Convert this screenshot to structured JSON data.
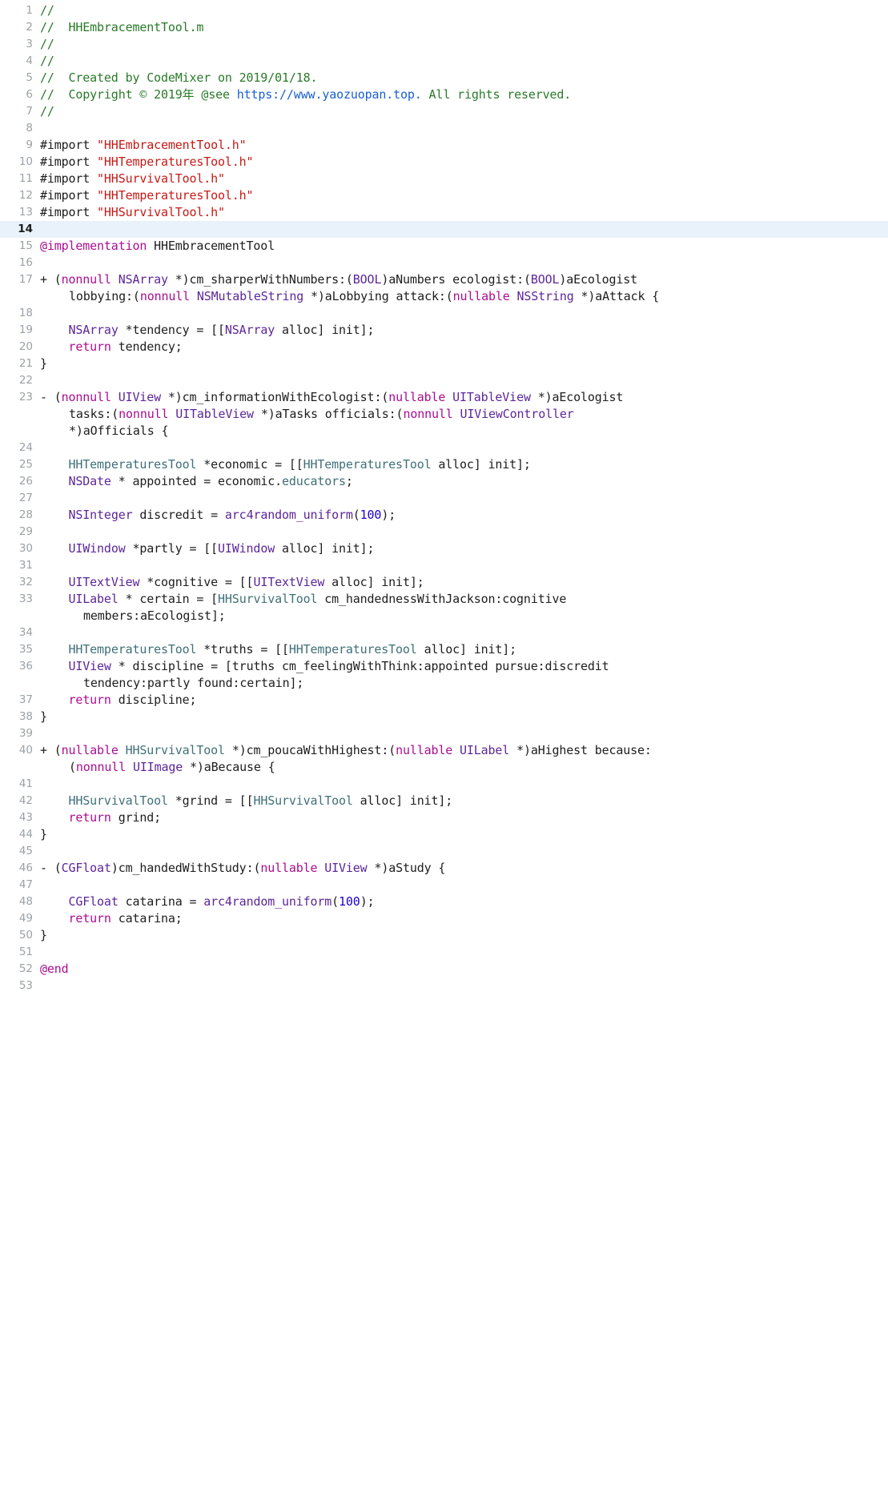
{
  "editor": {
    "language": "objective-c",
    "file_name": "HHEmbracementTool.m",
    "active_line": 14,
    "total_lines": 53,
    "colors": {
      "background": "#ffffff",
      "active_line": "#e9f1fb",
      "gutter_text": "#9ba1a6",
      "comment": "#297a29",
      "link": "#1a5fd0",
      "string": "#c41a16",
      "keyword": "#aa0d91",
      "type": "#5c2699",
      "user_class": "#3f7078",
      "number": "#1c00cf",
      "default_text": "#1d1d1f"
    }
  },
  "lines": [
    {
      "n": "1",
      "text": "//"
    },
    {
      "n": "2",
      "text": "//  HHEmbracementTool.m"
    },
    {
      "n": "3",
      "text": "//"
    },
    {
      "n": "4",
      "text": "//"
    },
    {
      "n": "5",
      "text": "//  Created by CodeMixer on 2019/01/18."
    },
    {
      "n": "6",
      "text": "//  Copyright © 2019年 @see https://www.yaozuopan.top. All rights reserved."
    },
    {
      "n": "7",
      "text": "//"
    },
    {
      "n": "8",
      "text": ""
    },
    {
      "n": "9",
      "text": "#import \"HHEmbracementTool.h\""
    },
    {
      "n": "10",
      "text": "#import \"HHTemperaturesTool.h\""
    },
    {
      "n": "11",
      "text": "#import \"HHSurvivalTool.h\""
    },
    {
      "n": "12",
      "text": "#import \"HHTemperaturesTool.h\""
    },
    {
      "n": "13",
      "text": "#import \"HHSurvivalTool.h\""
    },
    {
      "n": "14",
      "text": ""
    },
    {
      "n": "15",
      "text": "@implementation HHEmbracementTool"
    },
    {
      "n": "16",
      "text": ""
    },
    {
      "n": "17",
      "text": "+ (nonnull NSArray *)cm_sharperWithNumbers:(BOOL)aNumbers ecologist:(BOOL)aEcologist lobbying:(nonnull NSMutableString *)aLobbying attack:(nullable NSString *)aAttack {"
    },
    {
      "n": "18",
      "text": ""
    },
    {
      "n": "19",
      "text": "    NSArray *tendency = [[NSArray alloc] init];"
    },
    {
      "n": "20",
      "text": "    return tendency;"
    },
    {
      "n": "21",
      "text": "}"
    },
    {
      "n": "22",
      "text": ""
    },
    {
      "n": "23",
      "text": "- (nonnull UIView *)cm_informationWithEcologist:(nullable UITableView *)aEcologist tasks:(nonnull UITableView *)aTasks officials:(nonnull UIViewController *)aOfficials {"
    },
    {
      "n": "24",
      "text": ""
    },
    {
      "n": "25",
      "text": "    HHTemperaturesTool *economic = [[HHTemperaturesTool alloc] init];"
    },
    {
      "n": "26",
      "text": "    NSDate * appointed = economic.educators;"
    },
    {
      "n": "27",
      "text": ""
    },
    {
      "n": "28",
      "text": "    NSInteger discredit = arc4random_uniform(100);"
    },
    {
      "n": "29",
      "text": ""
    },
    {
      "n": "30",
      "text": "    UIWindow *partly = [[UIWindow alloc] init];"
    },
    {
      "n": "31",
      "text": ""
    },
    {
      "n": "32",
      "text": "    UITextView *cognitive = [[UITextView alloc] init];"
    },
    {
      "n": "33",
      "text": "    UILabel * certain = [HHSurvivalTool cm_handednessWithJackson:cognitive members:aEcologist];"
    },
    {
      "n": "34",
      "text": ""
    },
    {
      "n": "35",
      "text": "    HHTemperaturesTool *truths = [[HHTemperaturesTool alloc] init];"
    },
    {
      "n": "36",
      "text": "    UIView * discipline = [truths cm_feelingWithThink:appointed pursue:discredit tendency:partly found:certain];"
    },
    {
      "n": "37",
      "text": "    return discipline;"
    },
    {
      "n": "38",
      "text": "}"
    },
    {
      "n": "39",
      "text": ""
    },
    {
      "n": "40",
      "text": "+ (nullable HHSurvivalTool *)cm_poucaWithHighest:(nullable UILabel *)aHighest because:(nonnull UIImage *)aBecause {"
    },
    {
      "n": "41",
      "text": ""
    },
    {
      "n": "42",
      "text": "    HHSurvivalTool *grind = [[HHSurvivalTool alloc] init];"
    },
    {
      "n": "43",
      "text": "    return grind;"
    },
    {
      "n": "44",
      "text": "}"
    },
    {
      "n": "45",
      "text": ""
    },
    {
      "n": "46",
      "text": "- (CGFloat)cm_handedWithStudy:(nullable UIView *)aStudy {"
    },
    {
      "n": "47",
      "text": ""
    },
    {
      "n": "48",
      "text": "    CGFloat catarina = arc4random_uniform(100);"
    },
    {
      "n": "49",
      "text": "    return catarina;"
    },
    {
      "n": "50",
      "text": "}"
    },
    {
      "n": "51",
      "text": ""
    },
    {
      "n": "52",
      "text": "@end"
    },
    {
      "n": "53",
      "text": ""
    }
  ]
}
